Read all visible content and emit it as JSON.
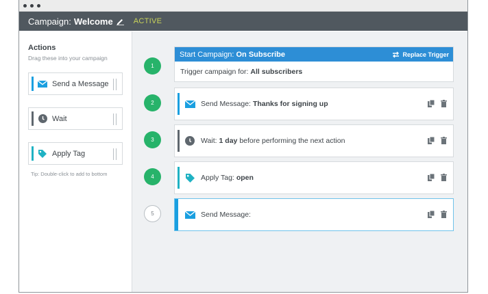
{
  "header": {
    "campaign_label": "Campaign:",
    "campaign_name": "Welcome",
    "status": "ACTIVE"
  },
  "sidebar": {
    "title": "Actions",
    "hint": "Drag these into your campaign",
    "items": [
      {
        "label": "Send a Message",
        "icon": "envelope-icon",
        "color": "#1a9fe0"
      },
      {
        "label": "Wait",
        "icon": "clock-icon",
        "color": "#5f676e"
      },
      {
        "label": "Apply Tag",
        "icon": "tag-icon",
        "color": "#1fb2c3"
      }
    ],
    "tip": "Tip: Double-click to add to bottom"
  },
  "steps": [
    {
      "number": "1",
      "state": "complete"
    },
    {
      "number": "2",
      "state": "complete"
    },
    {
      "number": "3",
      "state": "complete"
    },
    {
      "number": "4",
      "state": "complete"
    },
    {
      "number": "5",
      "state": "pending"
    }
  ],
  "trigger": {
    "head_label": "Start Campaign:",
    "head_value": "On Subscribe",
    "replace_label": "Replace Trigger",
    "body_label": "Trigger campaign for:",
    "body_value": "All subscribers"
  },
  "actions": [
    {
      "type_label": "Send Message:",
      "value": "Thanks for signing up",
      "icon": "envelope-icon",
      "color": "#1a9fe0"
    },
    {
      "type_label": "Wait:",
      "value": "1 day",
      "suffix": "before performing the next action",
      "icon": "clock-icon",
      "color": "#5f676e"
    },
    {
      "type_label": "Apply Tag:",
      "value": "open",
      "icon": "tag-icon",
      "color": "#1fb2c3"
    },
    {
      "type_label": "Send Message:",
      "value": "",
      "icon": "envelope-icon",
      "color": "#1a9fe0"
    }
  ],
  "colors": {
    "header_bg": "#50585f",
    "status": "#c9d35a",
    "trigger_bg": "#2d8ed6",
    "step_complete": "#27b36a",
    "selected_border": "#6ec2ea",
    "main_bg": "#eff1f3"
  }
}
